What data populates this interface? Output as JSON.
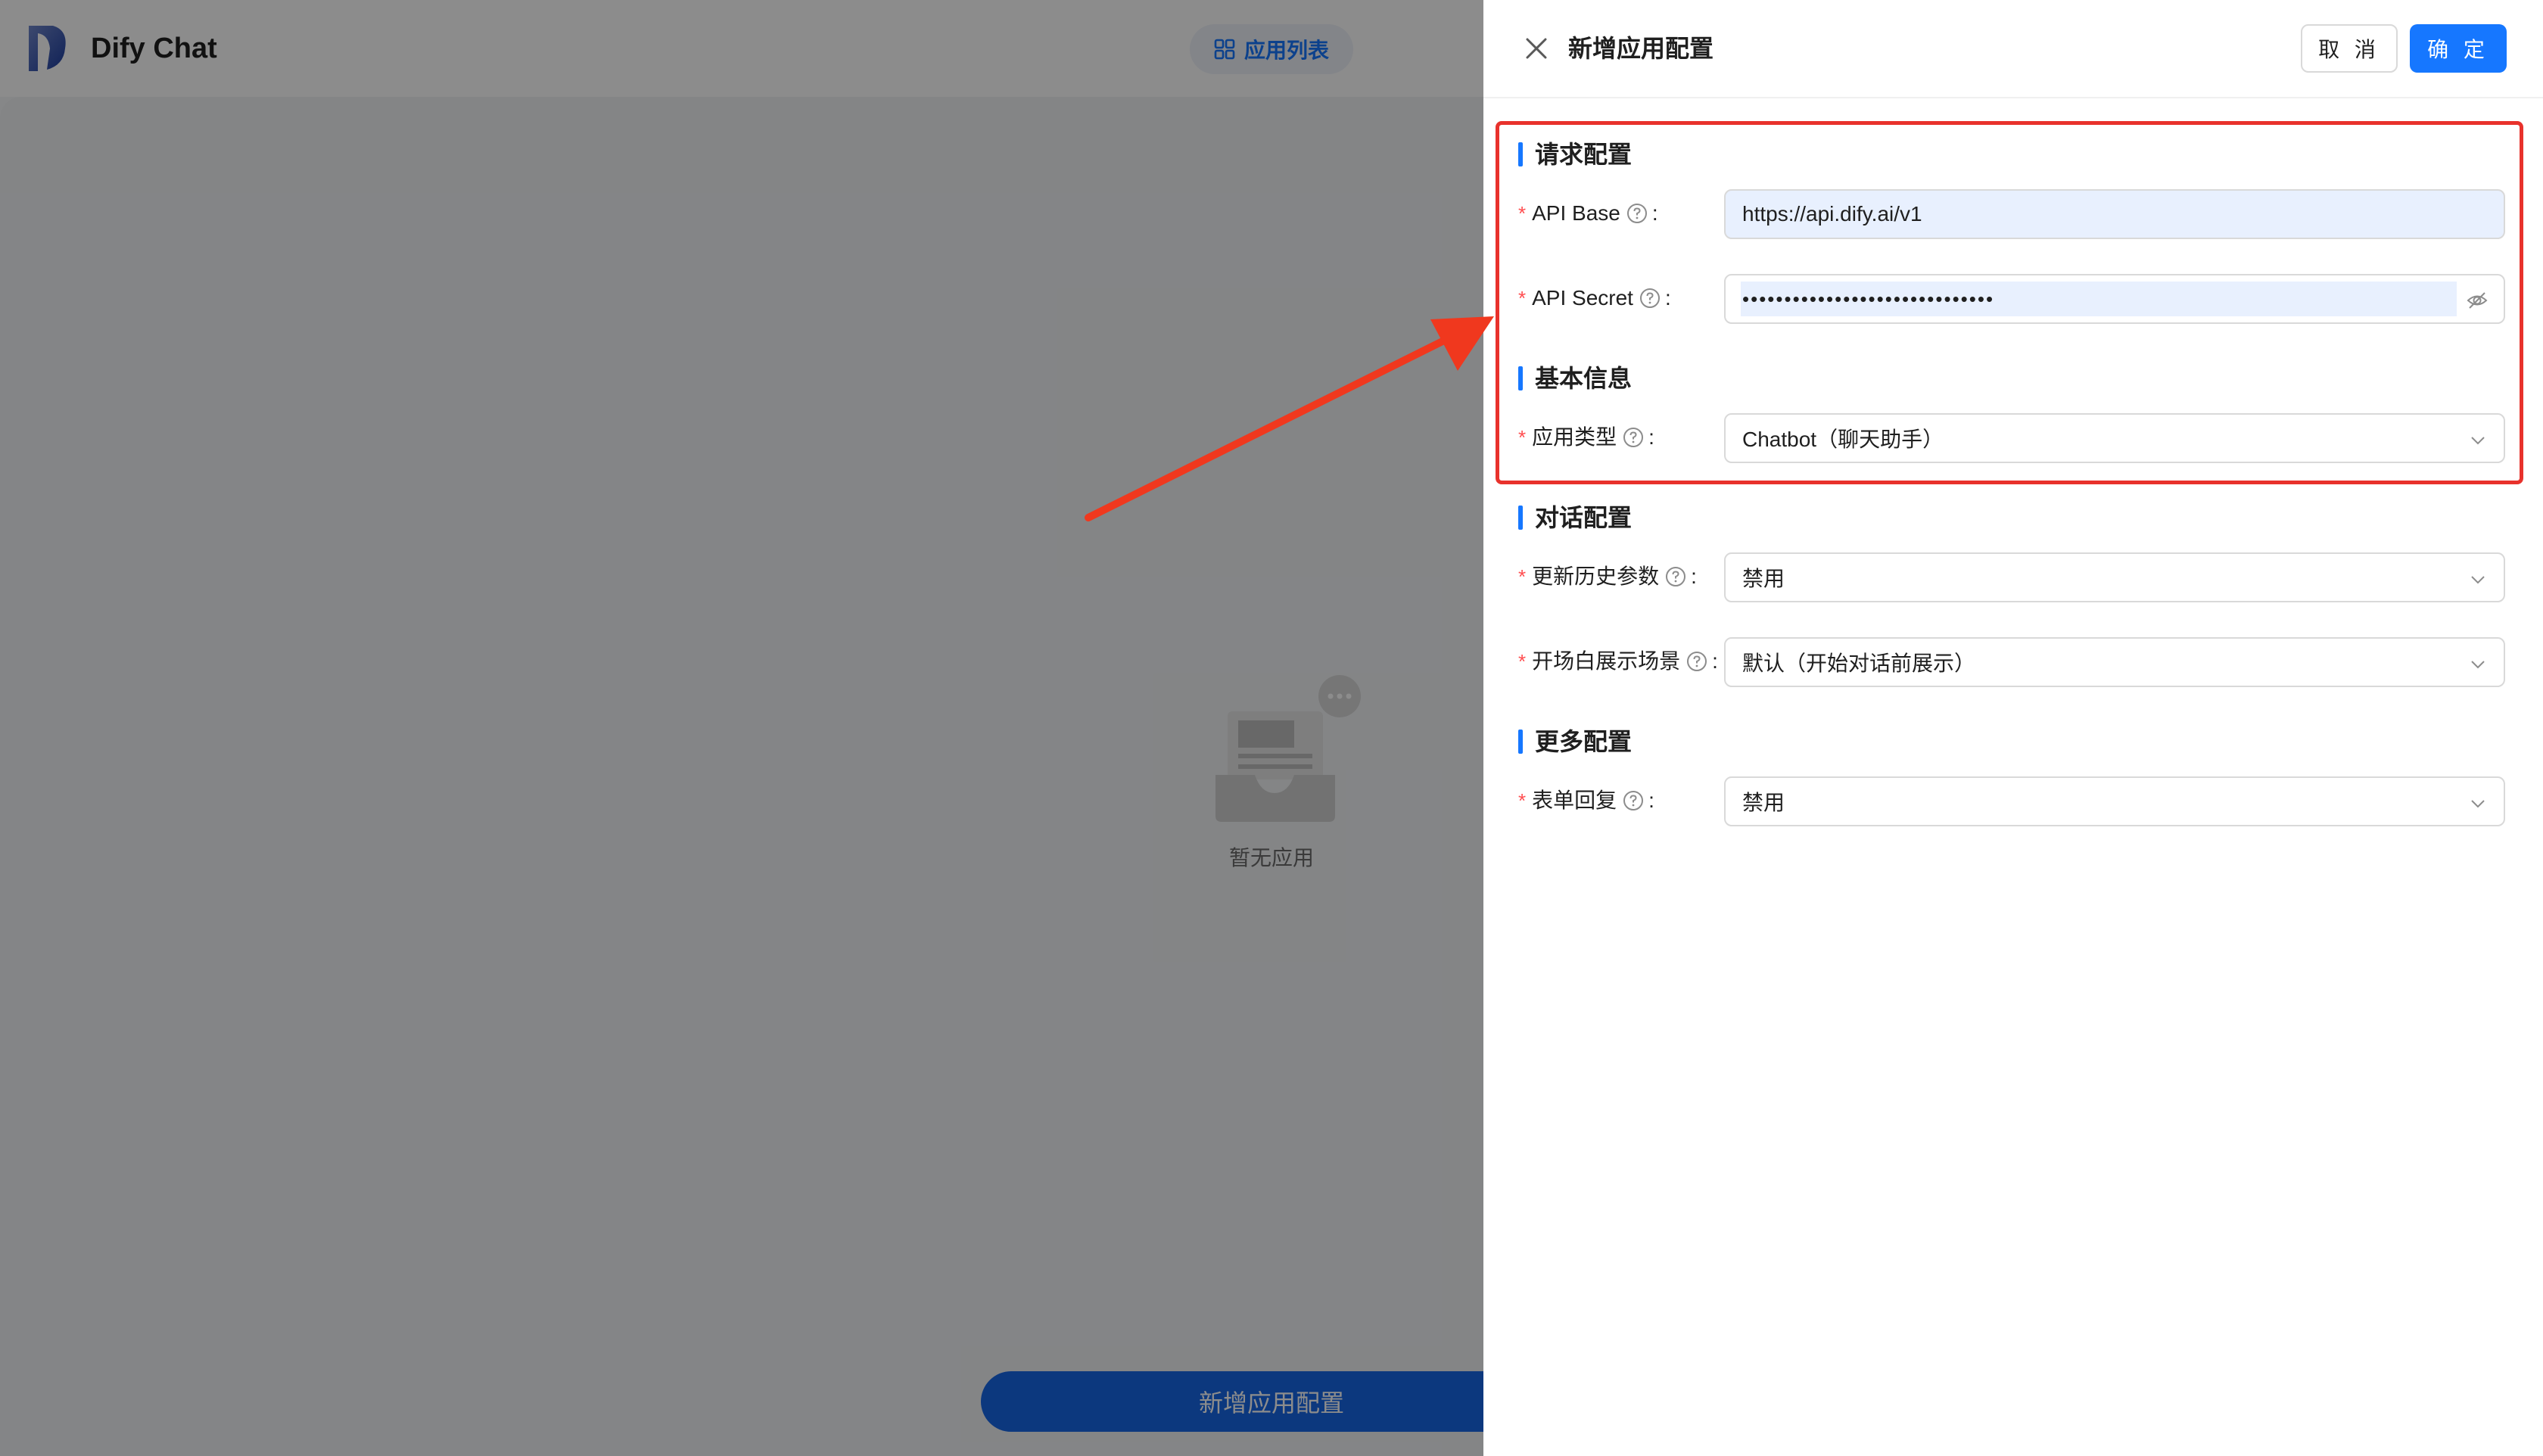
{
  "app": {
    "title": "Dify Chat",
    "app_list_label": "应用列表",
    "empty_text": "暂无应用",
    "new_config_label": "新增应用配置"
  },
  "drawer": {
    "title": "新增应用配置",
    "cancel_label": "取 消",
    "ok_label": "确 定",
    "sections": {
      "request": "请求配置",
      "basic": "基本信息",
      "dialog": "对话配置",
      "more": "更多配置"
    },
    "fields": {
      "api_base": {
        "label": "API Base",
        "value": "https://api.dify.ai/v1"
      },
      "api_secret": {
        "label": "API Secret",
        "value": "••••••••••••••••••••••••••••••"
      },
      "app_type": {
        "label": "应用类型",
        "value": "Chatbot（聊天助手）"
      },
      "update_history": {
        "label": "更新历史参数",
        "value": "禁用"
      },
      "opening_scene": {
        "label": "开场白展示场景",
        "value": "默认（开始对话前展示）"
      },
      "form_reply": {
        "label": "表单回复",
        "value": "禁用"
      }
    }
  },
  "colors": {
    "primary": "#1677ff",
    "required": "#ff4d4f",
    "annotation": "#e8322c",
    "autofill_bg": "#e8f0fe"
  },
  "icons": {
    "close": "close-icon",
    "help": "question-circle-icon",
    "eye": "eye-invisible-icon",
    "chevron": "chevron-down-icon",
    "grid": "app-grid-icon"
  }
}
